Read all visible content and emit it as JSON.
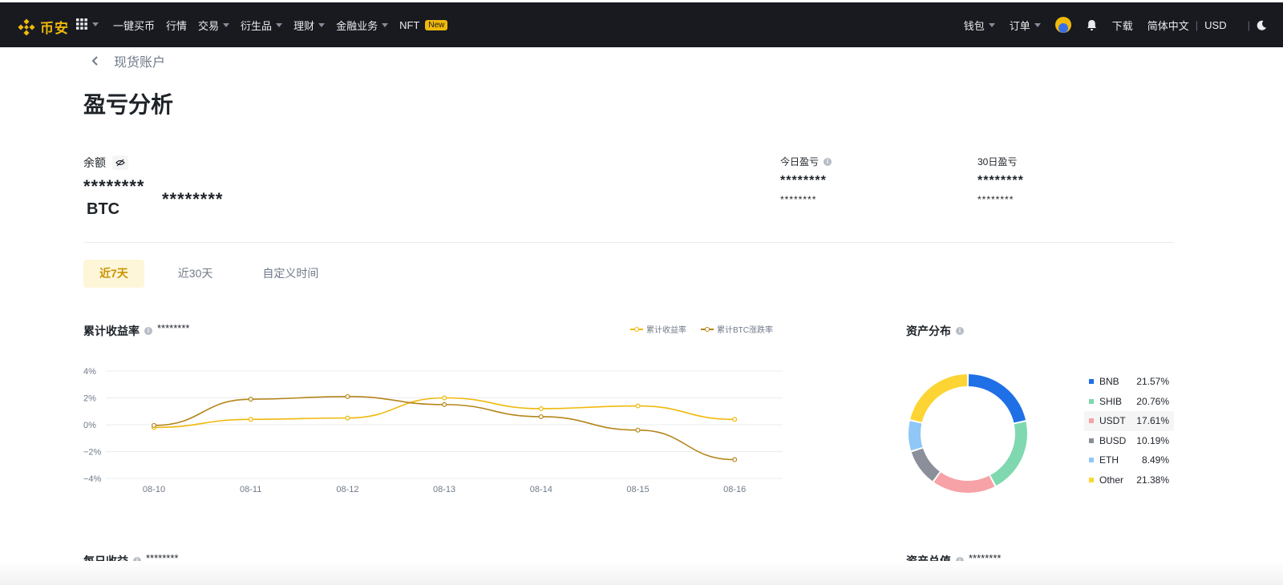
{
  "topbar": {
    "brand": "币安",
    "nav": [
      "一键买币",
      "行情",
      "交易",
      "衍生品",
      "理财",
      "金融业务",
      "NFT"
    ],
    "new_badge": "New",
    "wallet": "钱包",
    "orders": "订单",
    "download": "下载",
    "language": "简体中文",
    "currency": "USD"
  },
  "breadcrumb": "现货账户",
  "title": "盈亏分析",
  "balance": {
    "label": "余额",
    "value": "********",
    "unit": "BTC",
    "sub_value": "********"
  },
  "today_pnl": {
    "label": "今日盈亏",
    "value": "********",
    "sub": "********"
  },
  "pnl_30d": {
    "label": "30日盈亏",
    "value": "********",
    "sub": "********"
  },
  "tabs": [
    "近7天",
    "近30天",
    "自定义时间"
  ],
  "cumulative": {
    "title": "累计收益率",
    "value": "********"
  },
  "asset_dist": {
    "title": "资产分布"
  },
  "daily": {
    "title": "每日收益",
    "value": "********"
  },
  "total_assets": {
    "title": "资产总值",
    "value": "********"
  },
  "colors": {
    "brand": "#f0b90b",
    "series1": "#f0b90b",
    "series2": "#b5851a"
  },
  "chart_data": [
    {
      "type": "line",
      "x": [
        "08-10",
        "08-11",
        "08-12",
        "08-13",
        "08-14",
        "08-15",
        "08-16"
      ],
      "series": [
        {
          "name": "累计收益率",
          "values": [
            -0.2,
            0.4,
            0.5,
            2.0,
            1.2,
            1.4,
            0.4
          ]
        },
        {
          "name": "累计BTC涨跌率",
          "values": [
            -0.05,
            1.9,
            2.1,
            1.5,
            0.6,
            -0.4,
            -2.6
          ]
        }
      ],
      "ylim": [
        -4,
        4
      ],
      "yticks": [
        "4%",
        "2%",
        "0%",
        "−2%",
        "−4%"
      ],
      "grid": true,
      "legend": "top-right"
    },
    {
      "type": "pie",
      "categories": [
        "BNB",
        "SHIB",
        "USDT",
        "BUSD",
        "ETH",
        "Other"
      ],
      "labels": [
        "21.57%",
        "20.76%",
        "17.61%",
        "10.19%",
        "8.49%",
        "21.38%"
      ],
      "values": [
        21.57,
        20.76,
        17.61,
        10.19,
        8.49,
        21.38
      ],
      "colors": [
        "#1f6fe6",
        "#7fd8b0",
        "#f7a2a6",
        "#8a8f99",
        "#8fc7f7",
        "#fcd535"
      ],
      "legend": "right"
    }
  ]
}
